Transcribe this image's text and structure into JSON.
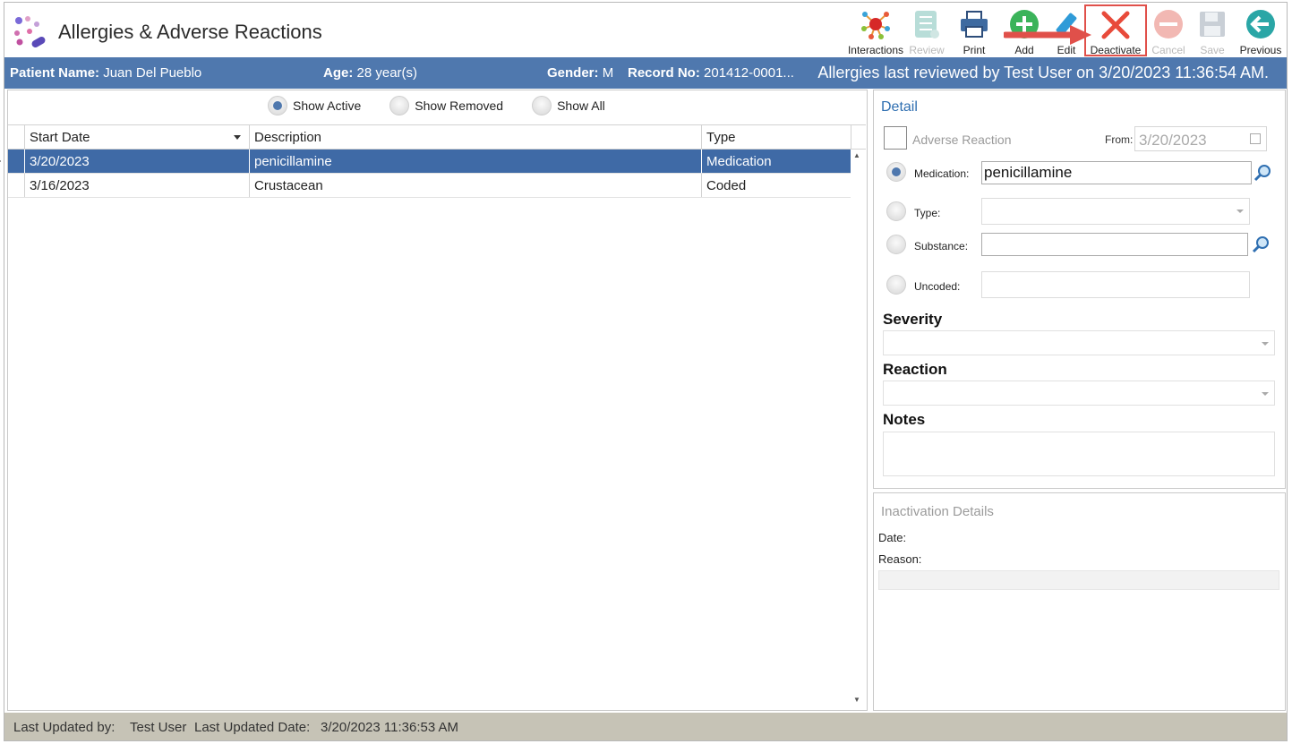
{
  "app": {
    "title": "Allergies & Adverse Reactions"
  },
  "toolbar": {
    "interactions": "Interactions",
    "review": "Review",
    "print": "Print",
    "add": "Add",
    "edit": "Edit",
    "deactivate": "Deactivate",
    "cancel": "Cancel",
    "save": "Save",
    "previous": "Previous"
  },
  "patient": {
    "name_label": "Patient Name:",
    "name": "Juan Del Pueblo",
    "age_label": "Age:",
    "age": "28 year(s)",
    "gender_label": "Gender:",
    "gender": "M",
    "record_label": "Record No:",
    "record": "201412-0001...",
    "reviewed": "Allergies last reviewed by Test User on 3/20/2023 11:36:54 AM."
  },
  "filter": {
    "options": [
      "Show Active",
      "Show Removed",
      "Show All"
    ],
    "selected": "Show Active"
  },
  "grid": {
    "columns": [
      "Start Date",
      "Description",
      "Type"
    ],
    "rows": [
      {
        "start_date": "3/20/2023",
        "description": "penicillamine",
        "type": "Medication",
        "selected": true
      },
      {
        "start_date": "3/16/2023",
        "description": "Crustacean",
        "type": "Coded",
        "selected": false
      }
    ]
  },
  "detail": {
    "title": "Detail",
    "adverse_reaction_label": "Adverse Reaction",
    "from_label": "From:",
    "from_value": "3/20/2023",
    "medication_label": "Medication:",
    "medication_value": "penicillamine",
    "type_label": "Type:",
    "substance_label": "Substance:",
    "uncoded_label": "Uncoded:",
    "severity_label": "Severity",
    "reaction_label": "Reaction",
    "notes_label": "Notes"
  },
  "inactivation": {
    "title": "Inactivation Details",
    "date_label": "Date:",
    "reason_label": "Reason:"
  },
  "status": {
    "updated_by_label": "Last Updated by:",
    "updated_by": "Test User",
    "updated_date_label": "Last Updated Date:",
    "updated_date": "3/20/2023 11:36:53 AM"
  },
  "colors": {
    "header_bar": "#4f78ae",
    "selected_row": "#3f6aa6",
    "status_bar": "#c6c3b6",
    "highlight": "#e0504a",
    "detail_title": "#2f6fb1"
  }
}
